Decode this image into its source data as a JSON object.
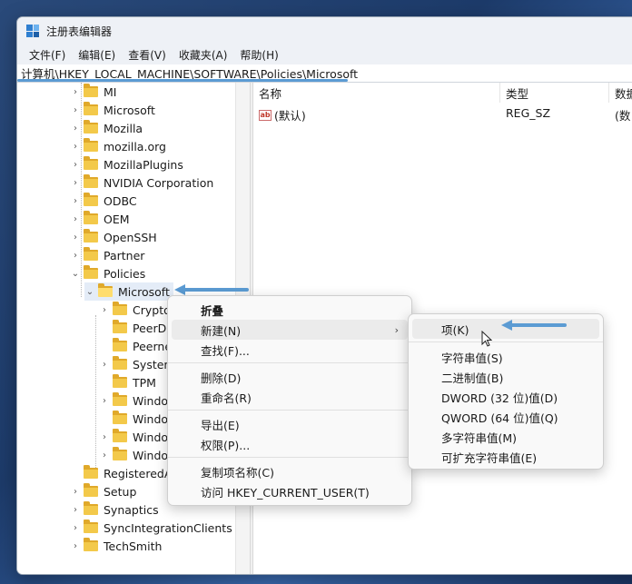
{
  "window": {
    "title": "注册表编辑器"
  },
  "menu": [
    "文件(F)",
    "编辑(E)",
    "查看(V)",
    "收藏夹(A)",
    "帮助(H)"
  ],
  "address": "计算机\\HKEY_LOCAL_MACHINE\\SOFTWARE\\Policies\\Microsoft",
  "tree": {
    "top_items": [
      "MI",
      "Microsoft",
      "Mozilla",
      "mozilla.org",
      "MozillaPlugins",
      "NVIDIA Corporation",
      "ODBC",
      "OEM",
      "OpenSSH",
      "Partner",
      "Policies"
    ],
    "selected": "Microsoft",
    "children": [
      "Cryptog",
      "PeerDis",
      "Peernet",
      "System",
      "TPM",
      "Window",
      "Window",
      "Window",
      "Window"
    ],
    "bottom_items": [
      "RegisteredAp",
      "Setup",
      "Synaptics",
      "SyncIntegrationClients",
      "TechSmith"
    ]
  },
  "values_pane": {
    "columns": [
      "名称",
      "类型",
      "数据"
    ],
    "rows": [
      {
        "name": "(默认)",
        "type": "REG_SZ",
        "data": "(数"
      }
    ]
  },
  "context_menu": {
    "collapse": "折叠",
    "new": "新建(N)",
    "find": "查找(F)...",
    "delete": "删除(D)",
    "rename": "重命名(R)",
    "export": "导出(E)",
    "permissions": "权限(P)...",
    "copy_key_name": "复制项名称(C)",
    "visit": "访问 HKEY_CURRENT_USER(T)"
  },
  "submenu": {
    "key": "项(K)",
    "string": "字符串值(S)",
    "binary": "二进制值(B)",
    "dword": "DWORD (32 位)值(D)",
    "qword": "QWORD (64 位)值(Q)",
    "multi_string": "多字符串值(M)",
    "expand_string": "可扩充字符串值(E)"
  },
  "colors": {
    "accent": "#5b9bd3",
    "folder": "#f3c94a"
  }
}
